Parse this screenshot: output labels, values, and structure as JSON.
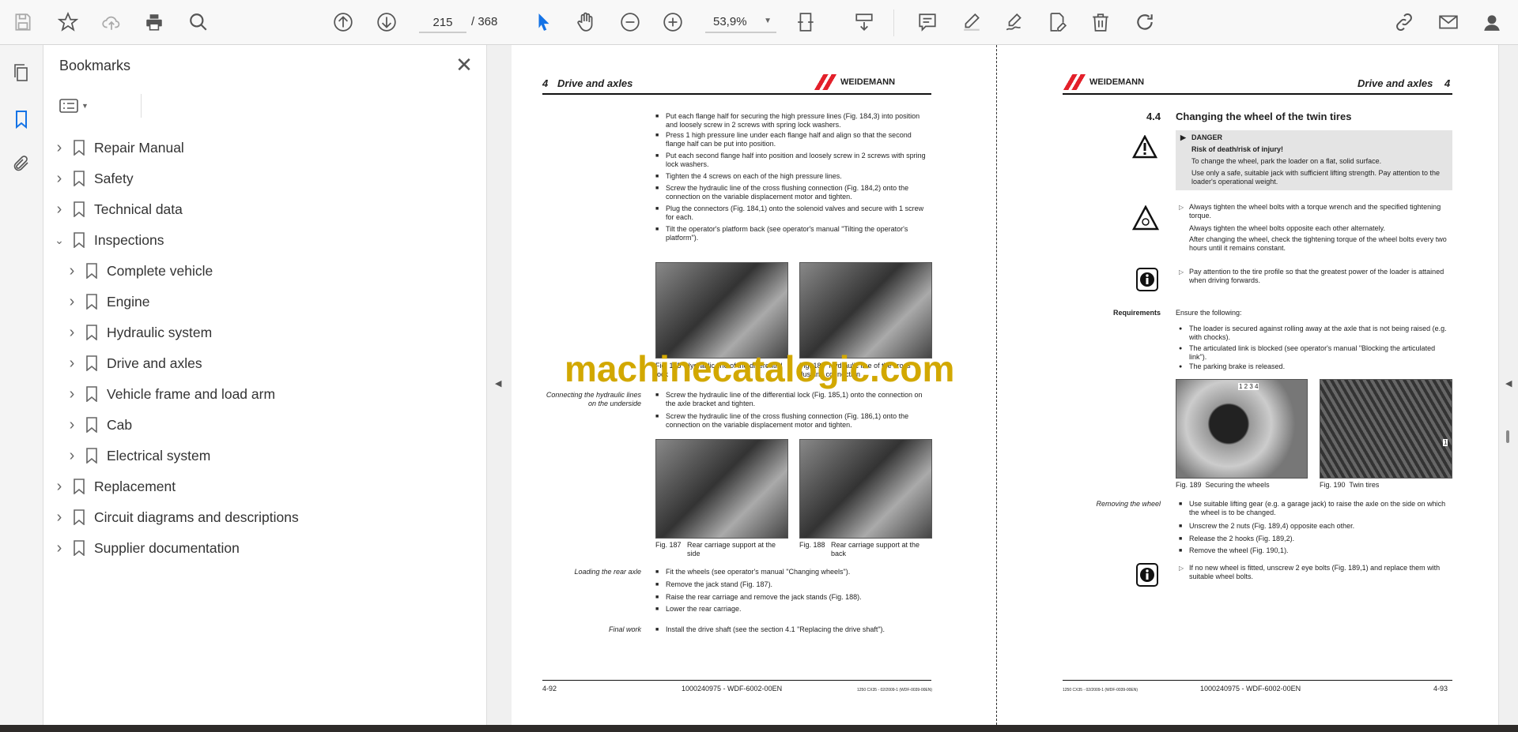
{
  "toolbar": {
    "page_current": "215",
    "page_total": "/ 368",
    "zoom": "53,9%",
    "icons": [
      "save-icon",
      "star-icon",
      "cloud-upload-icon",
      "print-icon",
      "search-icon",
      "page-up-icon",
      "page-down-icon",
      "select-cursor-icon",
      "hand-icon",
      "zoom-out-icon",
      "zoom-in-icon",
      "fit-page-icon",
      "scroll-mode-icon",
      "comment-icon",
      "highlight-pen-icon",
      "sign-icon",
      "edit-pdf-icon",
      "trash-icon",
      "rotate-icon",
      "share-link-icon",
      "mail-icon",
      "account-icon"
    ]
  },
  "bookmarks": {
    "title": "Bookmarks",
    "items": [
      {
        "label": "Repair Manual",
        "level": 0,
        "expanded": false
      },
      {
        "label": "Safety",
        "level": 0,
        "expanded": false
      },
      {
        "label": "Technical data",
        "level": 0,
        "expanded": false
      },
      {
        "label": "Inspections",
        "level": 0,
        "expanded": true
      },
      {
        "label": "Complete vehicle",
        "level": 1,
        "expanded": false
      },
      {
        "label": "Engine",
        "level": 1,
        "expanded": false
      },
      {
        "label": "Hydraulic system",
        "level": 1,
        "expanded": false
      },
      {
        "label": "Drive and axles",
        "level": 1,
        "expanded": false
      },
      {
        "label": "Vehicle frame and load arm",
        "level": 1,
        "expanded": false
      },
      {
        "label": "Cab",
        "level": 1,
        "expanded": false
      },
      {
        "label": "Electrical system",
        "level": 1,
        "expanded": false
      },
      {
        "label": "Replacement",
        "level": 0,
        "expanded": false
      },
      {
        "label": "Circuit diagrams and descriptions",
        "level": 0,
        "expanded": false
      },
      {
        "label": "Supplier documentation",
        "level": 0,
        "expanded": false
      }
    ]
  },
  "watermark": "machinecatalogic.com",
  "left_page": {
    "header_num": "4",
    "header_title": "Drive and axles",
    "logo": "WEIDEMANN",
    "steps_top": [
      "Put each flange half for securing the high pressure lines (Fig. 184,3) into position and loosely screw in 2 screws with spring lock washers.",
      "Press 1 high pressure line under each flange half and align so that the second flange half can be put into position.",
      "Put each second flange half into position and loosely screw in 2 screws with spring lock washers.",
      "Tighten the 4 screws on each of the high pressure lines.",
      "Screw the hydraulic line of the cross flushing connection (Fig. 184,2) onto the connection on the variable displacement motor and tighten.",
      "Plug the connectors (Fig. 184,1) onto the solenoid valves and secure with 1 screw for each.",
      "Tilt the operator's platform back (see operator's manual \"Tilting the operator's platform\")."
    ],
    "fig185": {
      "num": "Fig. 185",
      "text": "Hydraulic line of the differential lock"
    },
    "fig186": {
      "num": "Fig. 186",
      "text": "Hydraulic line of the cross flushing connection"
    },
    "connecting_label": "Connecting the hydraulic lines on the underside",
    "connecting_steps": [
      "Screw the hydraulic line of the differential lock (Fig. 185,1) onto the connection on the axle bracket and tighten.",
      "Screw the hydraulic line of the cross flushing connection (Fig. 186,1) onto the connection on the variable displacement motor and tighten."
    ],
    "fig187": {
      "num": "Fig. 187",
      "text": "Rear carriage support at the side"
    },
    "fig188": {
      "num": "Fig. 188",
      "text": "Rear carriage support at the back"
    },
    "loading_label": "Loading the rear axle",
    "loading_steps": [
      "Fit the wheels (see operator's manual \"Changing wheels\").",
      "Remove the jack stand (Fig. 187).",
      "Raise the rear carriage and remove the jack stands (Fig. 188).",
      "Lower the rear carriage."
    ],
    "final_label": "Final work",
    "final_steps": [
      "Install the drive shaft (see the section 4.1 \"Replacing the drive shaft\")."
    ],
    "footer_page": "4-92",
    "footer_doc": "1000240975 - WDF-6002-00EN",
    "footer_small": "1250 CX35 - 02/2009-1 (WDF-0039-00EN)"
  },
  "right_page": {
    "header_title": "Drive and axles",
    "header_num": "4",
    "logo": "WEIDEMANN",
    "section_num": "4.4",
    "section_title": "Changing the wheel of the twin tires",
    "danger": {
      "label": "DANGER",
      "subtitle": "Risk of death/risk of injury!",
      "line1": "To change the wheel, park the loader on a flat, solid surface.",
      "line2": "Use only a safe, suitable jack with sufficient lifting strength. Pay attention to the loader's operational weight."
    },
    "caution1": "Always tighten the wheel bolts with a torque wrench and the specified tightening torque.",
    "caution2": "Always tighten the wheel bolts opposite each other alternately.",
    "caution3": "After changing the wheel, check the tightening torque of the wheel bolts every two hours until it remains constant.",
    "info1": "Pay attention to the tire profile so that the greatest power of the loader is attained when driving forwards.",
    "requirements_label": "Requirements",
    "requirements_intro": "Ensure the following:",
    "requirements": [
      "The loader is secured against rolling away at the axle that is not being raised (e.g. with chocks).",
      "The articulated link is blocked (see operator's manual \"Blocking the articulated link\").",
      "The parking brake is released."
    ],
    "fig189": {
      "num": "Fig. 189",
      "text": "Securing the wheels",
      "callouts": "1 2  3 4"
    },
    "fig190": {
      "num": "Fig. 190",
      "text": "Twin tires",
      "callout": "1"
    },
    "removing_label": "Removing the wheel",
    "removing_steps": [
      "Use suitable lifting gear (e.g. a garage jack) to raise the axle on the side on which the wheel is to be changed.",
      "Unscrew the 2 nuts (Fig. 189,4) opposite each other.",
      "Release the 2 hooks (Fig. 189,2).",
      "Remove the wheel (Fig. 190,1)."
    ],
    "info2": "If no new wheel is fitted, unscrew 2 eye bolts (Fig. 189,1) and replace them with suitable wheel bolts.",
    "footer_small": "1250 CX35 - 02/2009-1 (WDF-0039-00EN)",
    "footer_doc": "1000240975 - WDF-6002-00EN",
    "footer_page": "4-93"
  },
  "colors": {
    "accent": "#1473e6",
    "watermark": "#d2a800",
    "logo_red": "#e3202a"
  }
}
